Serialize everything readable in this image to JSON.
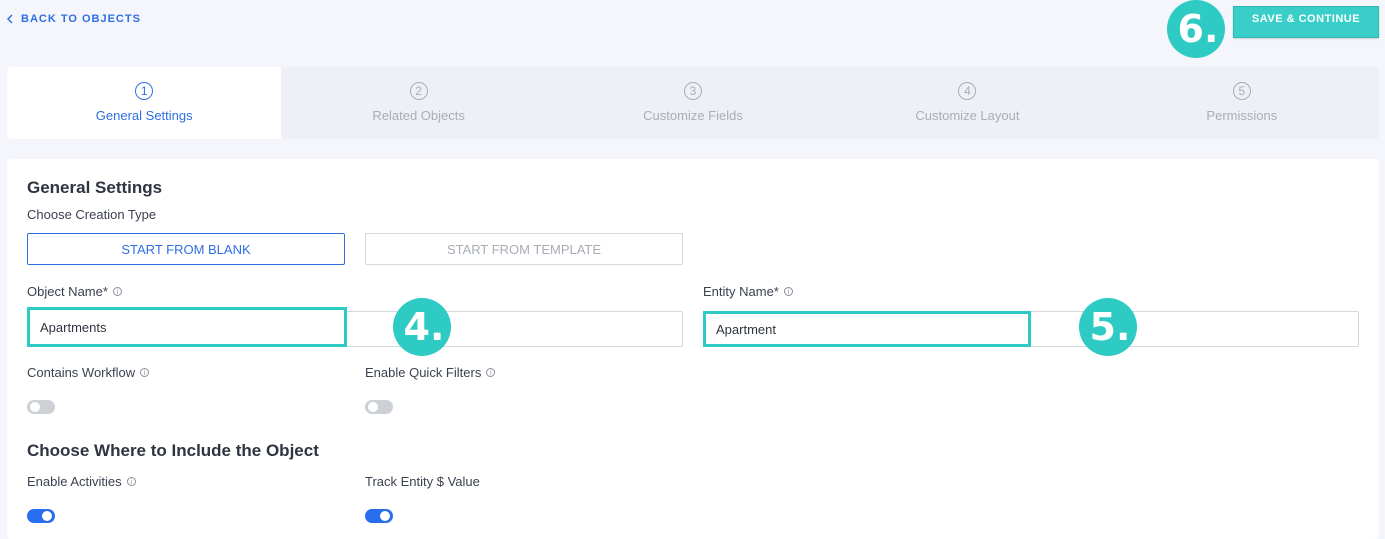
{
  "header": {
    "back_label": "BACK TO OBJECTS",
    "save_label": "SAVE & CONTINUE"
  },
  "markers": {
    "m4": "4.",
    "m5": "5.",
    "m6": "6."
  },
  "colors": {
    "accent_blue": "#2f6fe4",
    "highlight_teal": "#2ecbc4"
  },
  "steps": [
    {
      "number": "1",
      "label": "General Settings",
      "active": true
    },
    {
      "number": "2",
      "label": "Related Objects",
      "active": false
    },
    {
      "number": "3",
      "label": "Customize Fields",
      "active": false
    },
    {
      "number": "4",
      "label": "Customize Layout",
      "active": false
    },
    {
      "number": "5",
      "label": "Permissions",
      "active": false
    }
  ],
  "general": {
    "title": "General Settings",
    "creation_type_label": "Choose Creation Type",
    "blank_label": "START FROM BLANK",
    "template_label": "START FROM TEMPLATE",
    "object_name_label": "Object Name*",
    "object_name_value": "Apartments",
    "entity_name_label": "Entity Name*",
    "entity_name_value": "Apartment",
    "workflow_label": "Contains Workflow",
    "workflow_enabled": false,
    "quick_filters_label": "Enable Quick Filters",
    "quick_filters_enabled": false
  },
  "include": {
    "title": "Choose Where to Include the Object",
    "activities_label": "Enable Activities",
    "activities_enabled": true,
    "track_label": "Track Entity $ Value",
    "track_enabled": true
  }
}
